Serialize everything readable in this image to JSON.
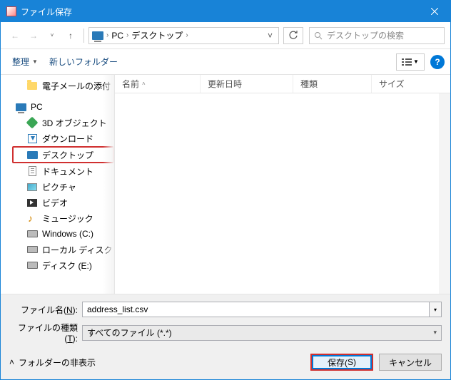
{
  "title": "ファイル保存",
  "breadcrumb": {
    "root": "PC",
    "folder": "デスクトップ"
  },
  "search": {
    "placeholder": "デスクトップの検索"
  },
  "toolbar": {
    "organize": "整理",
    "newfolder": "新しいフォルダー",
    "help": "?"
  },
  "tree": {
    "email": "電子メールの添付",
    "pc": "PC",
    "obj3d": "3D オブジェクト",
    "downloads": "ダウンロード",
    "desktop": "デスクトップ",
    "documents": "ドキュメント",
    "pictures": "ピクチャ",
    "videos": "ビデオ",
    "music": "ミュージック",
    "drivec": "Windows (C:)",
    "drived": "ローカル ディスク (D",
    "drivee": "ディスク (E:)"
  },
  "columns": {
    "name": "名前",
    "date": "更新日時",
    "type": "種類",
    "size": "サイズ"
  },
  "labels": {
    "filename_pre": "ファイル名(",
    "filename_u": "N",
    "filename_post": "):",
    "filetype_pre": "ファイルの種類(",
    "filetype_u": "T",
    "filetype_post": "):"
  },
  "filename": "address_list.csv",
  "filetype": "すべてのファイル (*.*)",
  "hide_folders": "フォルダーの非表示",
  "buttons": {
    "save_pre": "保存(",
    "save_u": "S",
    "save_post": ")",
    "cancel": "キャンセル"
  }
}
